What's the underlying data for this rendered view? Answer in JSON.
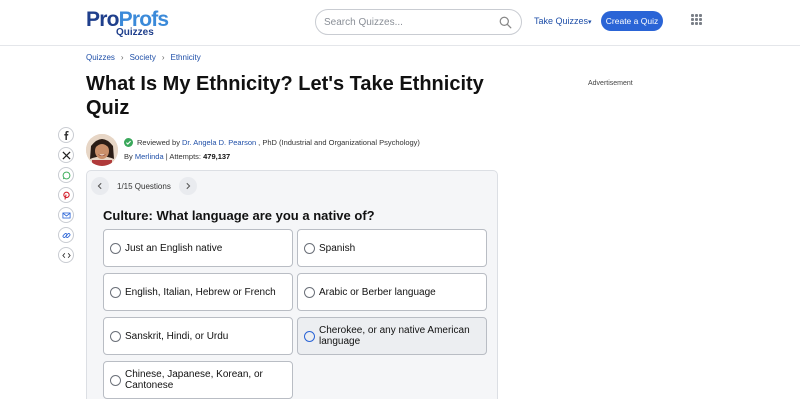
{
  "header": {
    "logo_main_a": "Pro",
    "logo_main_b": "Profs",
    "logo_sub": "Quizzes",
    "search_placeholder": "Search Quizzes...",
    "take_quizzes": "Take Quizzes",
    "create_quiz": "Create a Quiz"
  },
  "breadcrumb": [
    "Quizzes",
    "Society",
    "Ethnicity"
  ],
  "title": "What Is My Ethnicity? Let's Take Ethnicity Quiz",
  "advertisement": "Advertisement",
  "author": {
    "reviewed_prefix": "Reviewed by",
    "reviewer": "Dr. Angela D. Pearson",
    "reviewer_suffix": ", PhD (Industrial and Organizational Psychology)",
    "by_prefix": "By",
    "creator": "Merlinda",
    "attempts_label": "| Attempts:",
    "attempts": "479,137"
  },
  "quiz": {
    "counter": "1/15 Questions",
    "question": "Culture: What language are you a native of?",
    "options": [
      "Just an English native",
      "Spanish",
      "English, Italian, Hebrew or French",
      "Arabic or Berber language",
      "Sanskrit, Hindi, or Urdu",
      "Cherokee, or any native American language",
      "Chinese, Japanese, Korean, or Cantonese"
    ]
  },
  "colors": {
    "brand_dark": "#1f3f8c",
    "brand_light": "#3b8ad9",
    "primary_button": "#2a64d6",
    "link": "#1f4fa8",
    "verified": "#3aa85b"
  },
  "share_icons": [
    "facebook-icon",
    "x-icon",
    "whatsapp-icon",
    "pinterest-icon",
    "email-icon",
    "link-icon",
    "embed-icon"
  ]
}
